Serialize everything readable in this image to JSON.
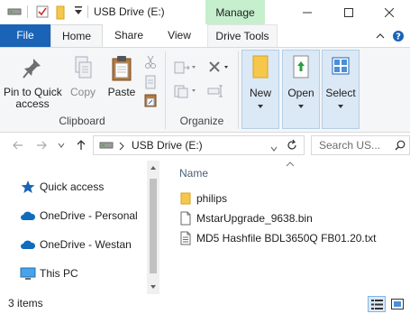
{
  "title_bar": {
    "path_title": "USB Drive (E:)",
    "context_tab": "Manage"
  },
  "ribbon_tabs": [
    "File",
    "Home",
    "Share",
    "View",
    "Drive Tools"
  ],
  "ribbon": {
    "clipboard": {
      "pin_label_1": "Pin to Quick",
      "pin_label_2": "access",
      "copy_label": "Copy",
      "paste_label": "Paste",
      "group_label": "Clipboard"
    },
    "organize": {
      "group_label": "Organize"
    },
    "new_label": "New",
    "open_label": "Open",
    "select_label": "Select"
  },
  "address_bar": {
    "location": "USB Drive (E:)",
    "search_placeholder": "Search US..."
  },
  "nav_pane": {
    "items": [
      "Quick access",
      "OneDrive - Personal",
      "OneDrive - Westan",
      "This PC"
    ]
  },
  "file_list": {
    "column_name": "Name",
    "files": [
      {
        "name": "philips",
        "type": "folder"
      },
      {
        "name": "MstarUpgrade_9638.bin",
        "type": "file"
      },
      {
        "name": "MD5 Hashfile BDL3650Q FB01.20.txt",
        "type": "text"
      }
    ]
  },
  "status_bar": {
    "item_count": "3 items"
  },
  "colors": {
    "file_tab": "#1a63b6",
    "manage_tab": "#c6efce",
    "ribbon_bg": "#f5f6f7",
    "selection_bg": "#dbe8f5",
    "folder_yellow": "#f5c84c",
    "onedrive_blue": "#0f6cbd"
  }
}
